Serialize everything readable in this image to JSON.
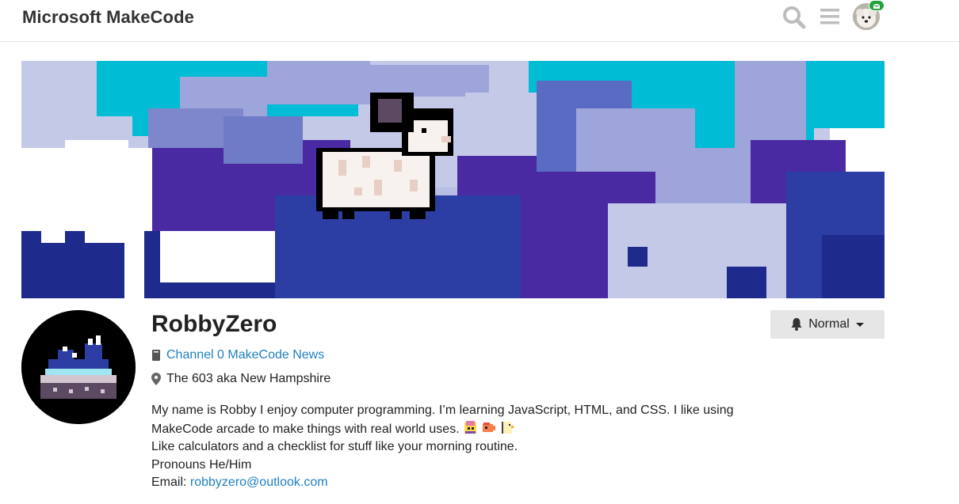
{
  "header": {
    "brand": "Microsoft MakeCode",
    "icons": [
      "search-icon",
      "menu-icon",
      "avatar",
      "mail-icon"
    ]
  },
  "profile": {
    "username": "RobbyZero",
    "channel": "Channel 0 MakeCode News",
    "location": "The 603 aka New Hampshire",
    "bio": {
      "line1": "My name is Robby I enjoy computer programming. I’m learning JavaScript, HTML, and CSS. I like using",
      "line2": "MakeCode arcade to make things with real world uses.",
      "line3": "Like calculators and a checklist for stuff like your morning routine.",
      "line4": "Pronouns He/Him",
      "email_label": "Email:",
      "email": "robbyzero@outlook.com"
    },
    "notification": {
      "label": "Normal",
      "icon": "bell-icon"
    }
  },
  "colors": {
    "link": "#1f7fbf",
    "badge": "#21a33a",
    "button_bg": "#e6e6e6"
  }
}
